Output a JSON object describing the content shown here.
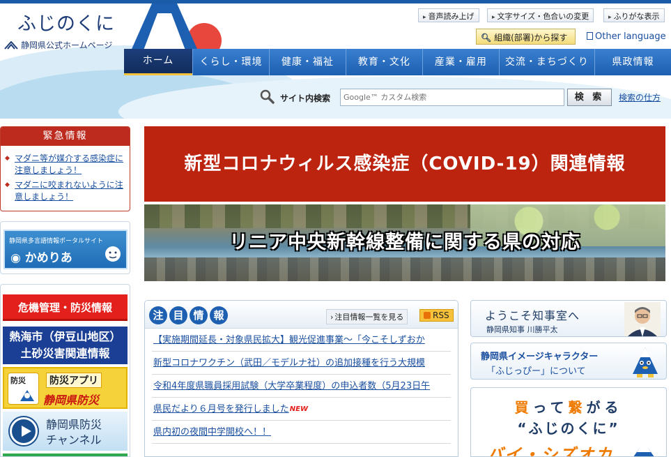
{
  "header": {
    "logo_title": "ふじのくに",
    "logo_sub": "静岡県公式ホームページ",
    "utility": [
      "音声読み上げ",
      "文字サイズ・色合いの変更",
      "ふりがな表示"
    ],
    "org_search": "組織(部署)から探す",
    "other_language": "Other language"
  },
  "nav": [
    "ホーム",
    "くらし・環境",
    "健康・福祉",
    "教育・文化",
    "産業・雇用",
    "交流・まちづくり",
    "県政情報"
  ],
  "search": {
    "label": "サイト内検索",
    "placeholder": "Google™ カスタム検索",
    "button": "検 索",
    "help": "検索の仕方"
  },
  "emergency": {
    "title": "緊急情報",
    "items": [
      "マダニ等が媒介する感染症に注意しましょう！",
      "マダニに咬まれないように注意しましょう！"
    ]
  },
  "kamerea": {
    "small": "静岡県多言語情報ポータルサイト",
    "big": "かめりあ"
  },
  "disaster": {
    "crisis": "危機管理・防災情報",
    "atami_line1": "熱海市（伊豆山地区）",
    "atami_line2": "土砂災害関連情報",
    "app_badge": "防災",
    "app_line1": "防災アプリ",
    "app_line2": "静岡県防災",
    "channel_line1": "静岡県防災",
    "channel_line2": "チャンネル"
  },
  "banners": {
    "covid": "新型コロナウィルス感染症（COVID-19）関連情報",
    "linear": "リニア中央新幹線整備に関する県の対応"
  },
  "news": {
    "title_chars": [
      "注",
      "目",
      "情",
      "報"
    ],
    "more": "注目情報一覧を見る",
    "rss": "RSS",
    "new_label": "NEW",
    "items": [
      "【実施期間延長・対象県民拡大】観光促進事業～「今こそしずおか",
      "新型コロナワクチン（武田／モデルナ社）の追加接種を行う大規模",
      "令和4年度県職員採用試験（大学卒業程度）の申込者数（5月23日午",
      "県民だより６月号を発行しました",
      "県内初の夜間中学開校へ！！"
    ]
  },
  "right": {
    "governor_title": "ようこそ知事室へ",
    "governor_sub": "静岡県知事 川勝平太",
    "fujippy_title": "静岡県イメージキャラクター",
    "fujippy_sub": "「ふじっぴー」について",
    "buy_line1_a": "買",
    "buy_line1_b": "って",
    "buy_line1_c": "繋",
    "buy_line1_d": "がる",
    "buy_line2": "“ふじのくに”",
    "buy_line3": "バイ・シズオカ"
  },
  "colors": {
    "brand_blue": "#1d5fb1",
    "emergency_red": "#bd2a1e",
    "covid_red": "#bc2410",
    "link_blue": "#1a4fa0",
    "accent_orange": "#ef7a00"
  }
}
